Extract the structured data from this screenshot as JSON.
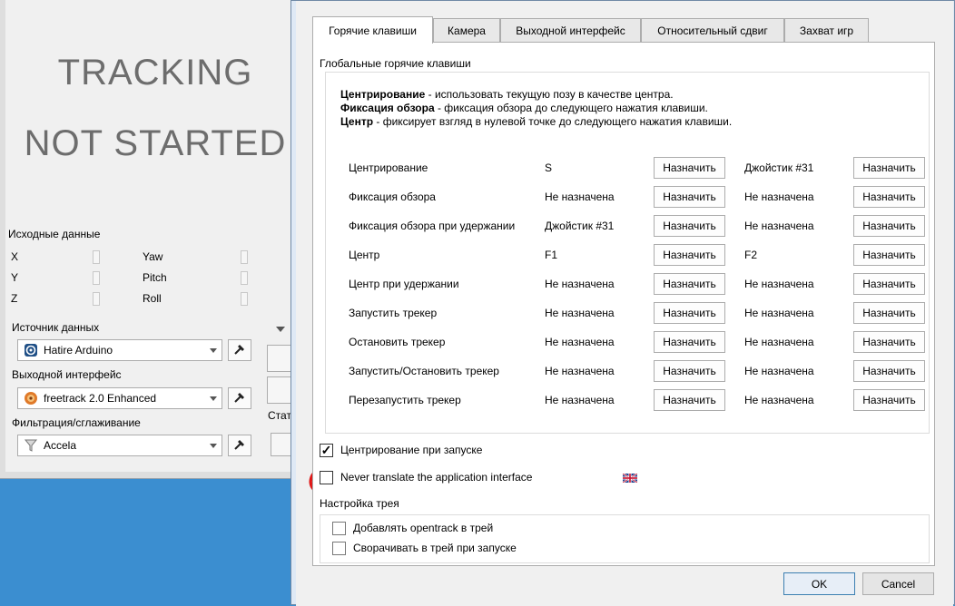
{
  "main_window": {
    "status_line1": "TRACKING",
    "status_line2": "NOT STARTED",
    "raw_data_title": "Исходные данные",
    "axes": {
      "x": "X",
      "y": "Y",
      "z": "Z",
      "yaw": "Yaw",
      "pitch": "Pitch",
      "roll": "Roll"
    },
    "input_label": "Источник данных",
    "input_value": "Hatire Arduino",
    "input_icon": "arduino-icon",
    "output_label": "Выходной интерфейс",
    "output_value": "freetrack 2.0 Enhanced",
    "output_icon": "freetrack-icon",
    "filter_label": "Фильтрация/сглаживание",
    "filter_value": "Accela",
    "filter_icon": "filter-funnel-icon",
    "stat_label": "Стат"
  },
  "dialog": {
    "tabs": [
      {
        "label": "Горячие клавиши",
        "active": true
      },
      {
        "label": "Камера",
        "active": false
      },
      {
        "label": "Выходной интерфейс",
        "active": false
      },
      {
        "label": "Относительный сдвиг",
        "active": false
      },
      {
        "label": "Захват игр",
        "active": false
      }
    ],
    "global_hotkeys_title": "Глобальные горячие клавиши",
    "descriptions": [
      {
        "term": "Центрирование",
        "text": " - использовать текущую позу в качестве центра."
      },
      {
        "term": "Фиксация обзора",
        "text": " - фиксация обзора до следующего нажатия клавиши."
      },
      {
        "term": "Центр",
        "text": " - фиксирует взгляд в нулевой точке до следующего нажатия клавиши."
      }
    ],
    "assign_label": "Назначить",
    "hotkeys": [
      {
        "name": "Центрирование",
        "key1": "S",
        "key2": "Джойстик #31"
      },
      {
        "name": "Фиксация обзора",
        "key1": "Не назначена",
        "key2": "Не назначена"
      },
      {
        "name": "Фиксация обзора при удержании",
        "key1": "Джойстик #31",
        "key2": "Не назначена"
      },
      {
        "name": "Центр",
        "key1": "F1",
        "key2": "F2"
      },
      {
        "name": "Центр при удержании",
        "key1": "Не назначена",
        "key2": "Не назначена"
      },
      {
        "name": "Запустить трекер",
        "key1": "Не назначена",
        "key2": "Не назначена"
      },
      {
        "name": "Остановить трекер",
        "key1": "Не назначена",
        "key2": "Не назначена"
      },
      {
        "name": "Запустить/Остановить трекер",
        "key1": "Не назначена",
        "key2": "Не назначена"
      },
      {
        "name": "Перезапустить трекер",
        "key1": "Не назначена",
        "key2": "Не назначена"
      }
    ],
    "center_at_startup": {
      "label": "Центрирование при запуске",
      "checked": true
    },
    "never_translate": {
      "label": "Never translate the application interface",
      "checked": false
    },
    "flag_icon": "uk-flag-icon",
    "tray_title": "Настройка трея",
    "tray_add": {
      "label": "Добавлять opentrack в трей",
      "checked": false
    },
    "tray_minimize": {
      "label": "Сворачивать в трей при запуске",
      "checked": false
    },
    "ok_label": "OK",
    "cancel_label": "Cancel"
  },
  "annotation_color": "#e01818",
  "accent_color": "#3c7fb1",
  "desktop_color": "#3b8ed0"
}
